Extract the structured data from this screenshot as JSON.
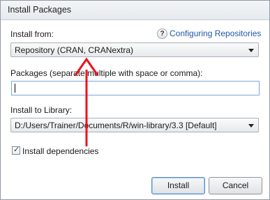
{
  "window": {
    "title": "Install Packages"
  },
  "install_from": {
    "label": "Install from:",
    "help_icon": "question-icon",
    "help_link": "Configuring Repositories",
    "selected": "Repository (CRAN, CRANextra)"
  },
  "packages": {
    "label": "Packages (separate multiple with space or comma):",
    "value": ""
  },
  "library": {
    "label": "Install to Library:",
    "selected": "D:/Users/Trainer/Documents/R/win-library/3.3 [Default]"
  },
  "dependencies": {
    "label": "Install dependencies",
    "checked": true
  },
  "buttons": {
    "install": "Install",
    "cancel": "Cancel"
  },
  "annotation": {
    "arrow_color": "#e8141b"
  }
}
